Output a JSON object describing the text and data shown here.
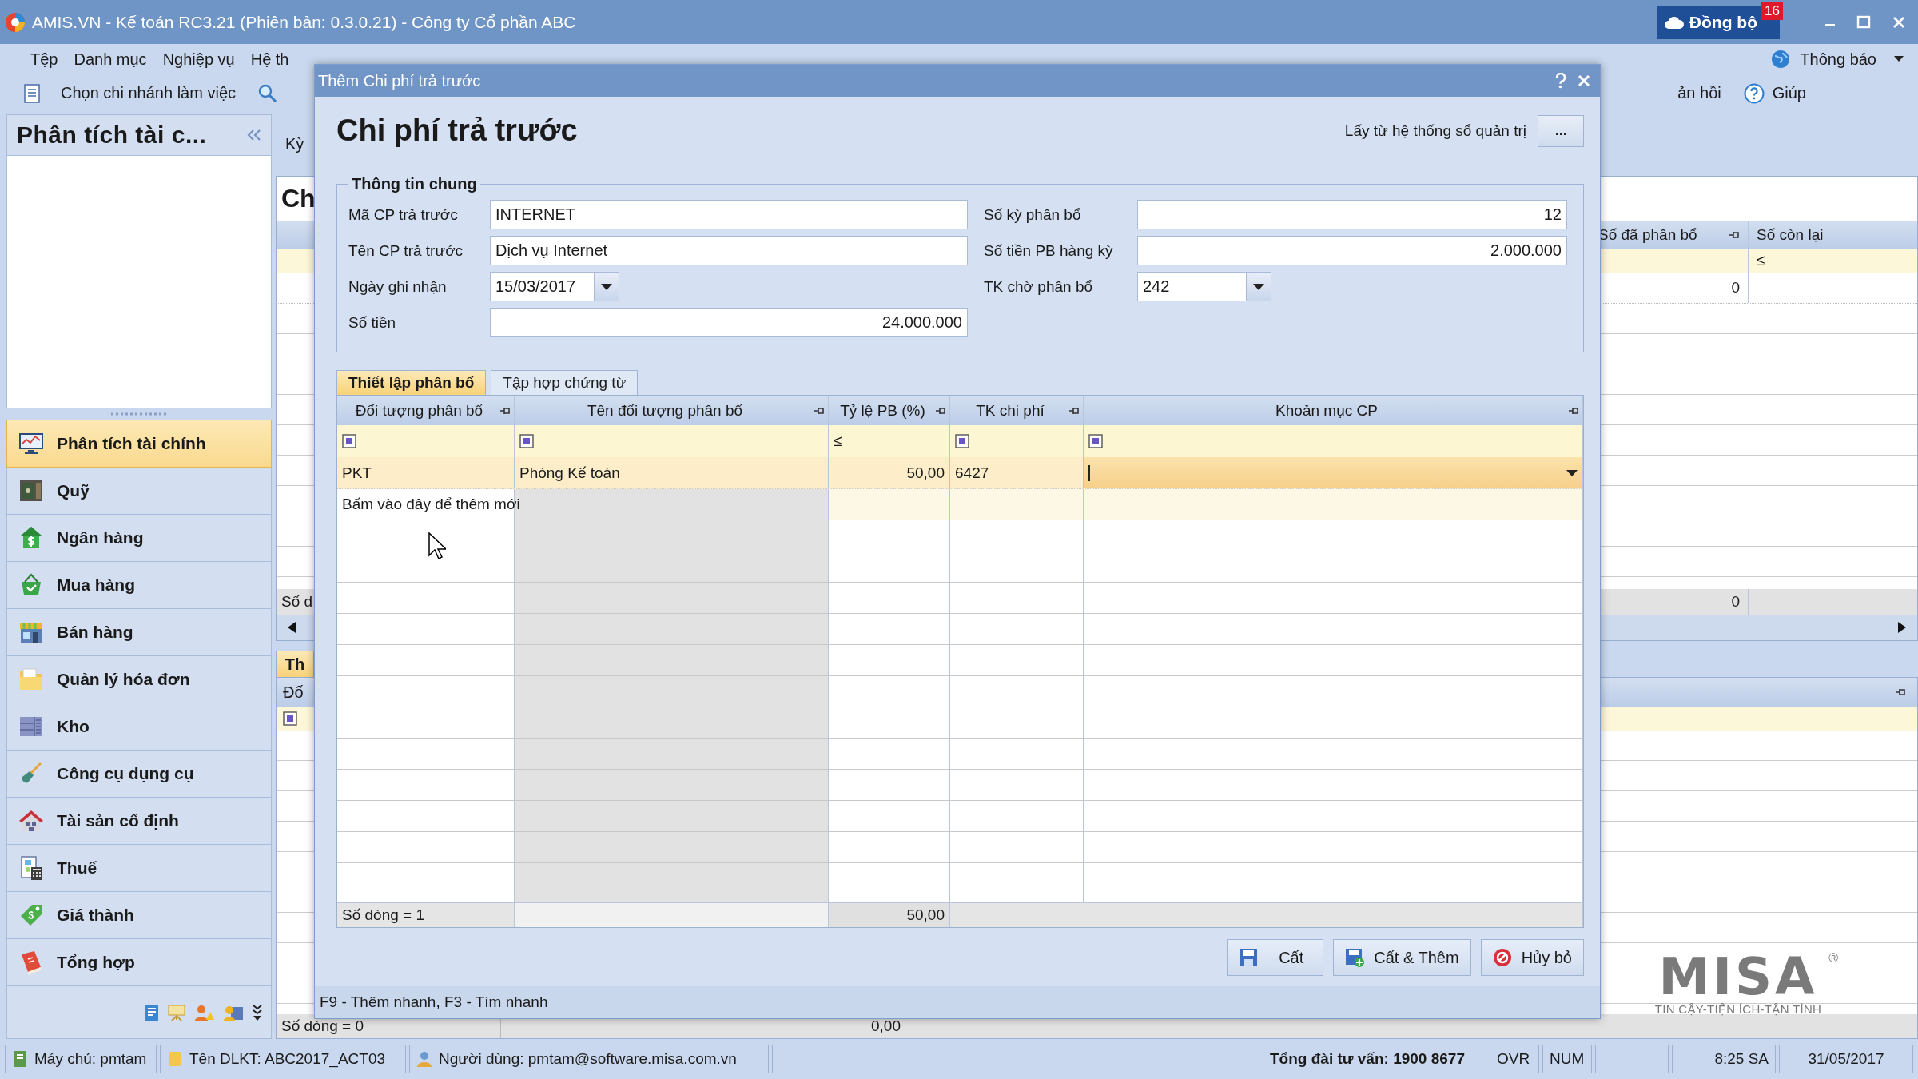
{
  "window": {
    "title": "AMIS.VN - Kế toán RC3.21 (Phiên bản: 0.3.0.21) - Công ty Cổ phần ABC",
    "sync_button": "Đồng bộ",
    "sync_badge": "16"
  },
  "menu": [
    "Tệp",
    "Danh mục",
    "Nghiệp vụ",
    "Hệ th"
  ],
  "toolbar": {
    "branch": "Chọn chi nhánh làm việc",
    "feedback": "ản hồi",
    "help": "Giúp",
    "notifications": "Thông báo"
  },
  "sidebar": {
    "title": "Phân tích tài c...",
    "items": [
      {
        "label": "Phân tích tài chính",
        "selected": true
      },
      {
        "label": "Quỹ",
        "selected": false
      },
      {
        "label": "Ngân hàng",
        "selected": false
      },
      {
        "label": "Mua hàng",
        "selected": false
      },
      {
        "label": "Bán hàng",
        "selected": false
      },
      {
        "label": "Quản lý hóa đơn",
        "selected": false
      },
      {
        "label": "Kho",
        "selected": false
      },
      {
        "label": "Công cụ dụng cụ",
        "selected": false
      },
      {
        "label": "Tài sản cố định",
        "selected": false
      },
      {
        "label": "Thuế",
        "selected": false
      },
      {
        "label": "Giá thành",
        "selected": false
      },
      {
        "label": "Tổng hợp",
        "selected": false
      }
    ]
  },
  "background": {
    "period_label": "Kỳ",
    "heading": "Ch",
    "columns": [
      "Số đã phân bổ",
      "Số còn lại"
    ],
    "filter": "≤",
    "row_value": "0",
    "footer_label": "Số d",
    "footer_value": "0",
    "lower_tab": "Th",
    "lower_column": "Đố",
    "lower_footer_label": "Số dòng = 0",
    "lower_footer_value": "0,00"
  },
  "dialog": {
    "title": "Thêm Chi phí trả trước",
    "heading": "Chi phí trả trước",
    "source_label": "Lấy từ hệ thống sổ quản trị",
    "source_button": "...",
    "group_title": "Thông tin chung",
    "left_fields": [
      {
        "label": "Mã CP trả trước",
        "value": "INTERNET",
        "kind": "text"
      },
      {
        "label": "Tên CP trả trước",
        "value": "Dịch vụ Internet",
        "kind": "text"
      },
      {
        "label": "Ngày ghi nhận",
        "value": "15/03/2017",
        "kind": "date"
      },
      {
        "label": "Số tiền",
        "value": "24.000.000",
        "kind": "number"
      }
    ],
    "right_fields": [
      {
        "label": "Số kỳ phân bổ",
        "value": "12",
        "kind": "number"
      },
      {
        "label": "Số tiền PB hàng kỳ",
        "value": "2.000.000",
        "kind": "number"
      },
      {
        "label": "TK chờ phân bổ",
        "value": "242",
        "kind": "combo"
      }
    ],
    "tabs": [
      {
        "label": "Thiết lập phân bổ",
        "selected": true
      },
      {
        "label": "Tập hợp chứng từ",
        "selected": false
      }
    ],
    "grid": {
      "columns": [
        "Đối tượng phân bổ",
        "Tên đối tượng phân bổ",
        "Tỷ lệ PB (%)",
        "TK chi phí",
        "Khoản mục CP"
      ],
      "filters": [
        {
          "kind": "checkbox"
        },
        {
          "kind": "checkbox"
        },
        {
          "kind": "operator",
          "text": "≤"
        },
        {
          "kind": "checkbox"
        },
        {
          "kind": "checkbox"
        }
      ],
      "rows": [
        {
          "object": "PKT",
          "name": "Phòng Kế toán",
          "ratio": "50,00",
          "account": "6427",
          "editing": true
        }
      ],
      "new_row_hint": "Bấm vào đây để thêm mới",
      "footer_count": "Số dòng = 1",
      "footer_total": "50,00"
    },
    "buttons": [
      {
        "label": "Cất",
        "kind": "save"
      },
      {
        "label": "Cất & Thêm",
        "kind": "save-add"
      },
      {
        "label": "Hủy bỏ",
        "kind": "cancel"
      }
    ],
    "shortcuts": "F9 - Thêm nhanh, F3 - Tìm nhanh"
  },
  "logo": {
    "name": "MISA",
    "mark": "®",
    "tagline": "TIN CẬY-TIỆN ÍCH-TẬN TÌNH"
  },
  "status_bar": {
    "server": "Máy chủ: pmtam",
    "database": "Tên DLKT: ABC2017_ACT03",
    "user": "Người dùng: pmtam@software.misa.com.vn",
    "hotline": "Tổng đài tư vấn: 1900 8677",
    "ovr": "OVR",
    "num": "NUM",
    "time": "8:25 SA",
    "date": "31/05/2017"
  }
}
